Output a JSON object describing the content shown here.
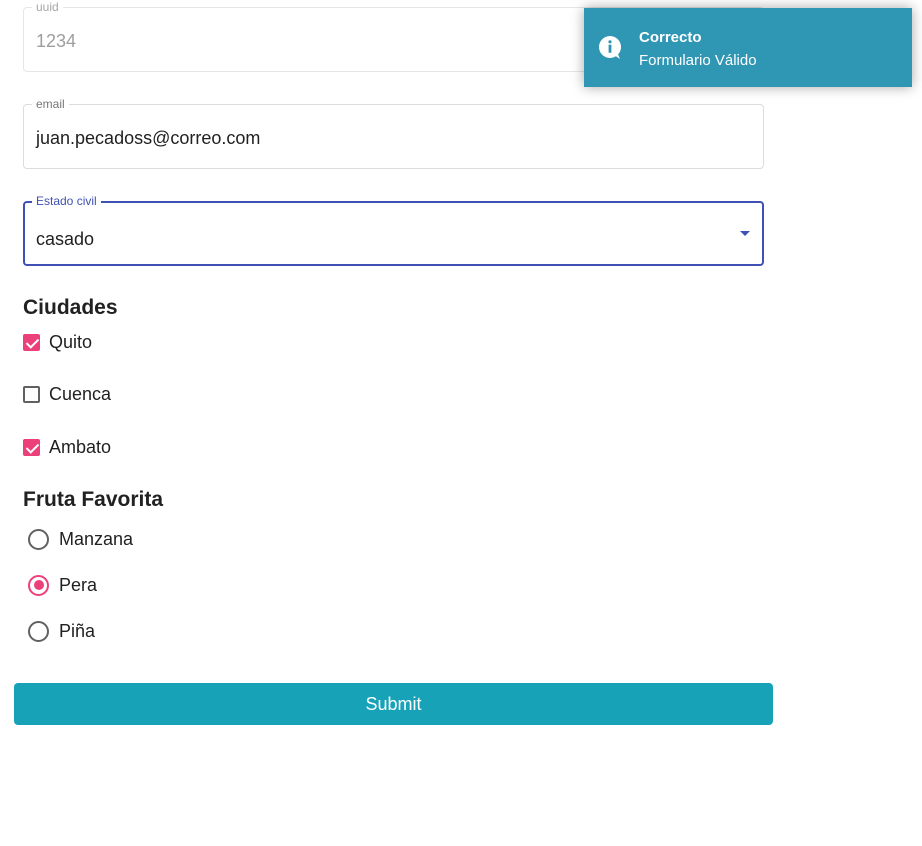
{
  "form": {
    "uuid": {
      "label": "uuid",
      "value": "1234"
    },
    "email": {
      "label": "email",
      "value": "juan.pecadoss@correo.com"
    },
    "estado_civil": {
      "label": "Estado civil",
      "value": "casado"
    },
    "ciudades": {
      "title": "Ciudades",
      "options": [
        {
          "label": "Quito",
          "checked": true
        },
        {
          "label": "Cuenca",
          "checked": false
        },
        {
          "label": "Ambato",
          "checked": true
        }
      ]
    },
    "fruta": {
      "title": "Fruta Favorita",
      "options": [
        {
          "label": "Manzana",
          "selected": false
        },
        {
          "label": "Pera",
          "selected": true
        },
        {
          "label": "Piña",
          "selected": false
        }
      ]
    },
    "submit_label": "Submit"
  },
  "toast": {
    "title": "Correcto",
    "message": "Formulario Válido",
    "icon": "info-icon"
  },
  "colors": {
    "accent_pink": "#ec407a",
    "focus_indigo": "#3f51b5",
    "submit_teal": "#17a2b8",
    "toast_blue": "#2f96b4"
  }
}
